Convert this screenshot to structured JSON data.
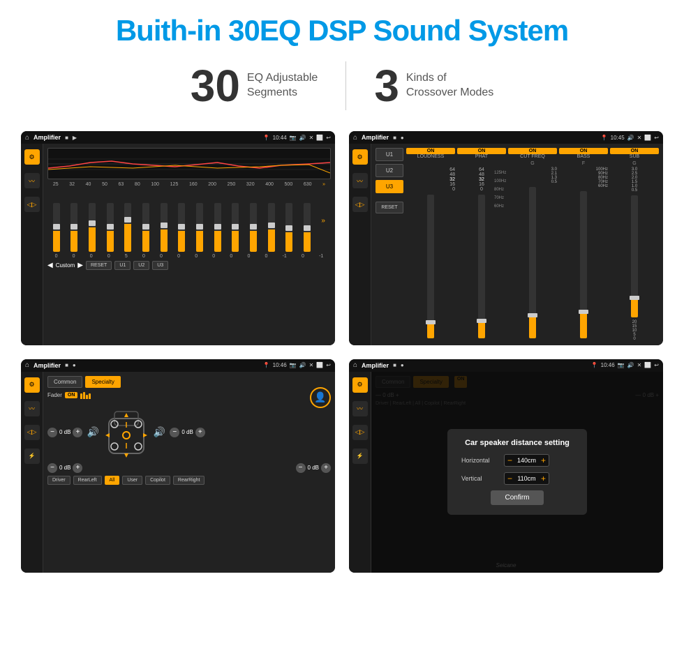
{
  "page": {
    "title": "Buith-in 30EQ DSP Sound System",
    "stat1_num": "30",
    "stat1_label1": "EQ Adjustable",
    "stat1_label2": "Segments",
    "stat2_num": "3",
    "stat2_label1": "Kinds of",
    "stat2_label2": "Crossover Modes",
    "watermark": "Seicane"
  },
  "screen1": {
    "title": "Amplifier",
    "time": "10:44",
    "freqs": [
      "25",
      "32",
      "40",
      "50",
      "63",
      "80",
      "100",
      "125",
      "160",
      "200",
      "250",
      "320",
      "400",
      "500",
      "630"
    ],
    "values": [
      "0",
      "0",
      "0",
      "0",
      "5",
      "0",
      "0",
      "0",
      "0",
      "0",
      "0",
      "0",
      "0",
      "-1",
      "0",
      "-1"
    ],
    "controls": {
      "custom": "Custom",
      "reset": "RESET",
      "u1": "U1",
      "u2": "U2",
      "u3": "U3"
    }
  },
  "screen2": {
    "title": "Amplifier",
    "time": "10:45",
    "presets": [
      "U1",
      "U2",
      "U3"
    ],
    "active_preset": "U3",
    "reset": "RESET",
    "channels": [
      "LOUDNESS",
      "PHAT",
      "CUT FREQ",
      "BASS",
      "SUB"
    ],
    "on_labels": [
      "ON",
      "ON",
      "ON",
      "ON",
      "ON"
    ]
  },
  "screen3": {
    "title": "Amplifier",
    "time": "10:46",
    "tabs": [
      "Common",
      "Specialty"
    ],
    "active_tab": "Specialty",
    "fader_label": "Fader",
    "fader_on": "ON",
    "db_labels": [
      "0 dB",
      "0 dB",
      "0 dB",
      "0 dB"
    ],
    "buttons": [
      "Driver",
      "RearLeft",
      "All",
      "User",
      "Copilot",
      "RearRight"
    ]
  },
  "screen4": {
    "title": "Amplifier",
    "time": "10:46",
    "tabs": [
      "Common",
      "Specialty"
    ],
    "modal": {
      "title": "Car speaker distance setting",
      "horizontal_label": "Horizontal",
      "horizontal_value": "140cm",
      "vertical_label": "Vertical",
      "vertical_value": "110cm",
      "confirm_btn": "Confirm"
    },
    "buttons": [
      "Driver",
      "RearLeft",
      "All",
      "User",
      "Copilot",
      "RearRight"
    ]
  }
}
